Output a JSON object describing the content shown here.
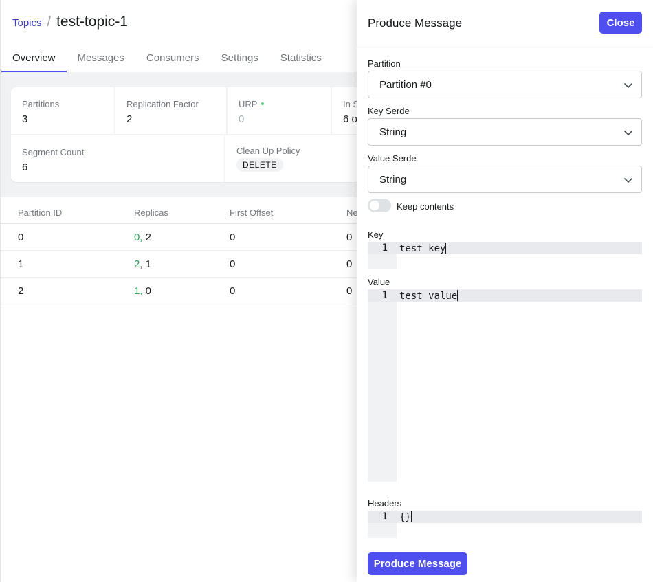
{
  "breadcrumb": {
    "link": "Topics",
    "separator": "/",
    "title": "test-topic-1"
  },
  "tabs": [
    {
      "label": "Overview",
      "active": true
    },
    {
      "label": "Messages"
    },
    {
      "label": "Consumers"
    },
    {
      "label": "Settings"
    },
    {
      "label": "Statistics"
    }
  ],
  "metrics": {
    "partitions": {
      "label": "Partitions",
      "value": "3"
    },
    "replication_factor": {
      "label": "Replication Factor",
      "value": "2"
    },
    "urp": {
      "label": "URP",
      "value": "0"
    },
    "in_sync": {
      "label": "In S",
      "value": "6 o"
    },
    "segment_count": {
      "label": "Segment Count",
      "value": "6"
    },
    "clean_up_policy": {
      "label": "Clean Up Policy",
      "value": "DELETE"
    }
  },
  "table": {
    "headers": [
      "Partition ID",
      "Replicas",
      "First Offset",
      "Ne"
    ],
    "rows": [
      {
        "id": "0",
        "leader": "0,",
        "replica": " 2",
        "first_offset": "0",
        "next": "0"
      },
      {
        "id": "1",
        "leader": "2,",
        "replica": " 1",
        "first_offset": "0",
        "next": "0"
      },
      {
        "id": "2",
        "leader": "1,",
        "replica": " 0",
        "first_offset": "0",
        "next": "0"
      }
    ]
  },
  "drawer": {
    "title": "Produce Message",
    "close_label": "Close",
    "partition": {
      "label": "Partition",
      "value": "Partition #0"
    },
    "key_serde": {
      "label": "Key Serde",
      "value": "String"
    },
    "value_serde": {
      "label": "Value Serde",
      "value": "String"
    },
    "keep_contents": {
      "label": "Keep contents",
      "checked": false
    },
    "key": {
      "label": "Key",
      "line_number": "1",
      "text": "test key"
    },
    "value": {
      "label": "Value",
      "line_number": "1",
      "text": "test value"
    },
    "headers": {
      "label": "Headers",
      "line_number": "1",
      "text": "{}"
    },
    "submit_label": "Produce Message"
  },
  "colors": {
    "accent": "#4f4ff0",
    "link": "#3b3bc6",
    "green": "#2f9e5a",
    "status_dot": "#5cd685"
  }
}
